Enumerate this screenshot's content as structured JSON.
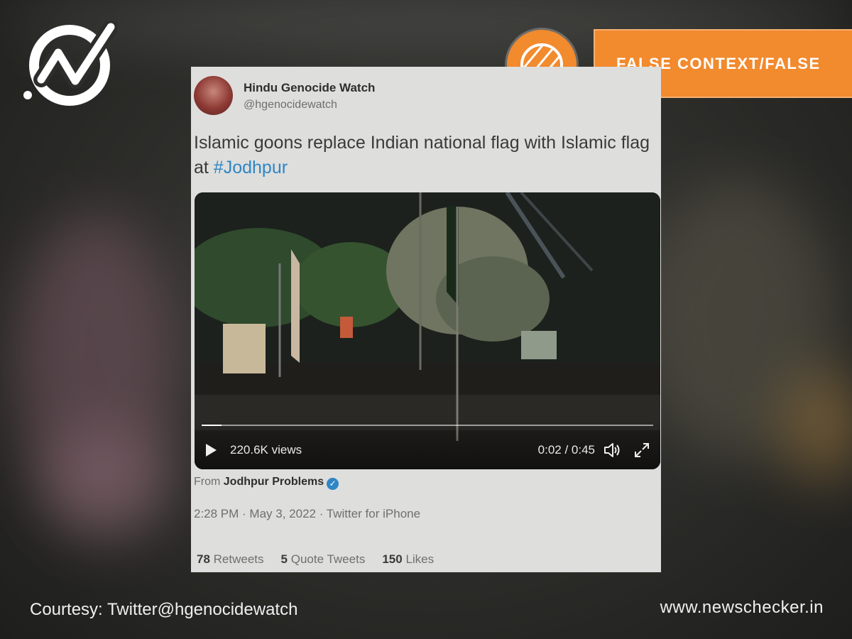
{
  "brand": {
    "site_url": "www.newschecker.in"
  },
  "verdict": {
    "label": "FALSE CONTEXT/FALSE",
    "color": "#f28a2e"
  },
  "tweet": {
    "author_name": "Hindu Genocide Watch",
    "author_handle": "@hgenocidewatch",
    "text_before": "Islamic goons replace Indian national flag with Islamic flag at ",
    "hashtag": "#Jodhpur",
    "video": {
      "views": "220.6K views",
      "time": "0:02 / 0:45",
      "progress_fraction": 0.044
    },
    "from_prefix": "From",
    "from_source": "Jodhpur Problems",
    "timestamp": "2:28 PM · May 3, 2022 · Twitter for iPhone",
    "stats": {
      "retweets_count": "78",
      "retweets_label": "Retweets",
      "quotes_count": "5",
      "quotes_label": "Quote Tweets",
      "likes_count": "150",
      "likes_label": "Likes"
    },
    "link_color": "#2f86c4"
  },
  "courtesy": "Courtesy: Twitter@hgenocidewatch"
}
